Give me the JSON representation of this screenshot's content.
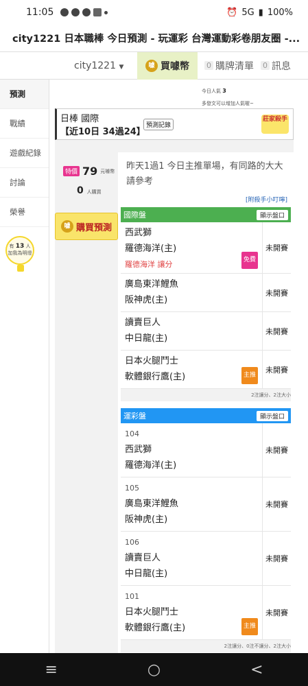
{
  "status_bar": {
    "time": "11:05",
    "network": "5G",
    "battery": "100%"
  },
  "page_title": "city1221 日本職棒 今日預測 - 玩運彩 台灣運動彩卷朋友圈 -...",
  "top_nav": {
    "site": "city1221",
    "coins_label": "買噱幣",
    "purchase_list": "購牌清單",
    "purchase_count": "0",
    "messages": "訊息",
    "message_count": "0"
  },
  "sidebar": {
    "items": [
      {
        "label": "預測"
      },
      {
        "label": "戰績"
      },
      {
        "label": "遊戲紀錄"
      },
      {
        "label": "討論"
      },
      {
        "label": "榮譽"
      }
    ],
    "bulb_prefix": "有",
    "bulb_count": "13",
    "bulb_suffix": "人",
    "bulb_text": "加我為明燈"
  },
  "popular": {
    "label": "今日人氣",
    "value": "3",
    "tip": "多發文可以增加人氣喔~"
  },
  "league": {
    "title": "日棒 國際",
    "record": "【近10日 34過24】",
    "record_btn": "預測記錄",
    "king_badge": "莊家殺手"
  },
  "pricing": {
    "tag": "特價",
    "price": "79",
    "unit": "元噱幣",
    "buyers": "0",
    "buyers_unit": "人購買",
    "buy_button": "購買預測"
  },
  "comment": "昨天1過1 今日主推單場，有同路的大大請參考",
  "helper_link": "[附殺手小叮嚀]",
  "intl_board": {
    "title": "國際盤",
    "show_btn": "顯示盤口",
    "rows": [
      {
        "team1": "西武獅",
        "team2": "羅德海洋(主)",
        "pick": "羅德海洋 讓分",
        "tag": "免費",
        "status": "未開賽"
      },
      {
        "team1": "廣島東洋鯉魚",
        "team2": "阪神虎(主)",
        "status": "未開賽"
      },
      {
        "team1": "讀賣巨人",
        "team2": "中日龍(主)",
        "status": "未開賽"
      },
      {
        "team1": "日本火腿鬥士",
        "team2": "軟體銀行鷹(主)",
        "tag": "主推",
        "status": "未開賽"
      }
    ],
    "footnote": "2注讓分、2注大小"
  },
  "lottery_board": {
    "title": "運彩盤",
    "show_btn": "顯示盤口",
    "rows": [
      {
        "num": "104",
        "team1": "西武獅",
        "team2": "羅德海洋(主)",
        "status": "未開賽"
      },
      {
        "num": "105",
        "team1": "廣島東洋鯉魚",
        "team2": "阪神虎(主)",
        "status": "未開賽"
      },
      {
        "num": "106",
        "team1": "讀賣巨人",
        "team2": "中日龍(主)",
        "status": "未開賽"
      },
      {
        "num": "101",
        "team1": "日本火腿鬥士",
        "team2": "軟體銀行鷹(主)",
        "tag": "主推",
        "status": "未開賽"
      }
    ],
    "footnote": "2注讓分、0注不讓分、2注大小"
  },
  "nav_bar": {
    "recent": "≡",
    "home": "○",
    "back": "<"
  }
}
